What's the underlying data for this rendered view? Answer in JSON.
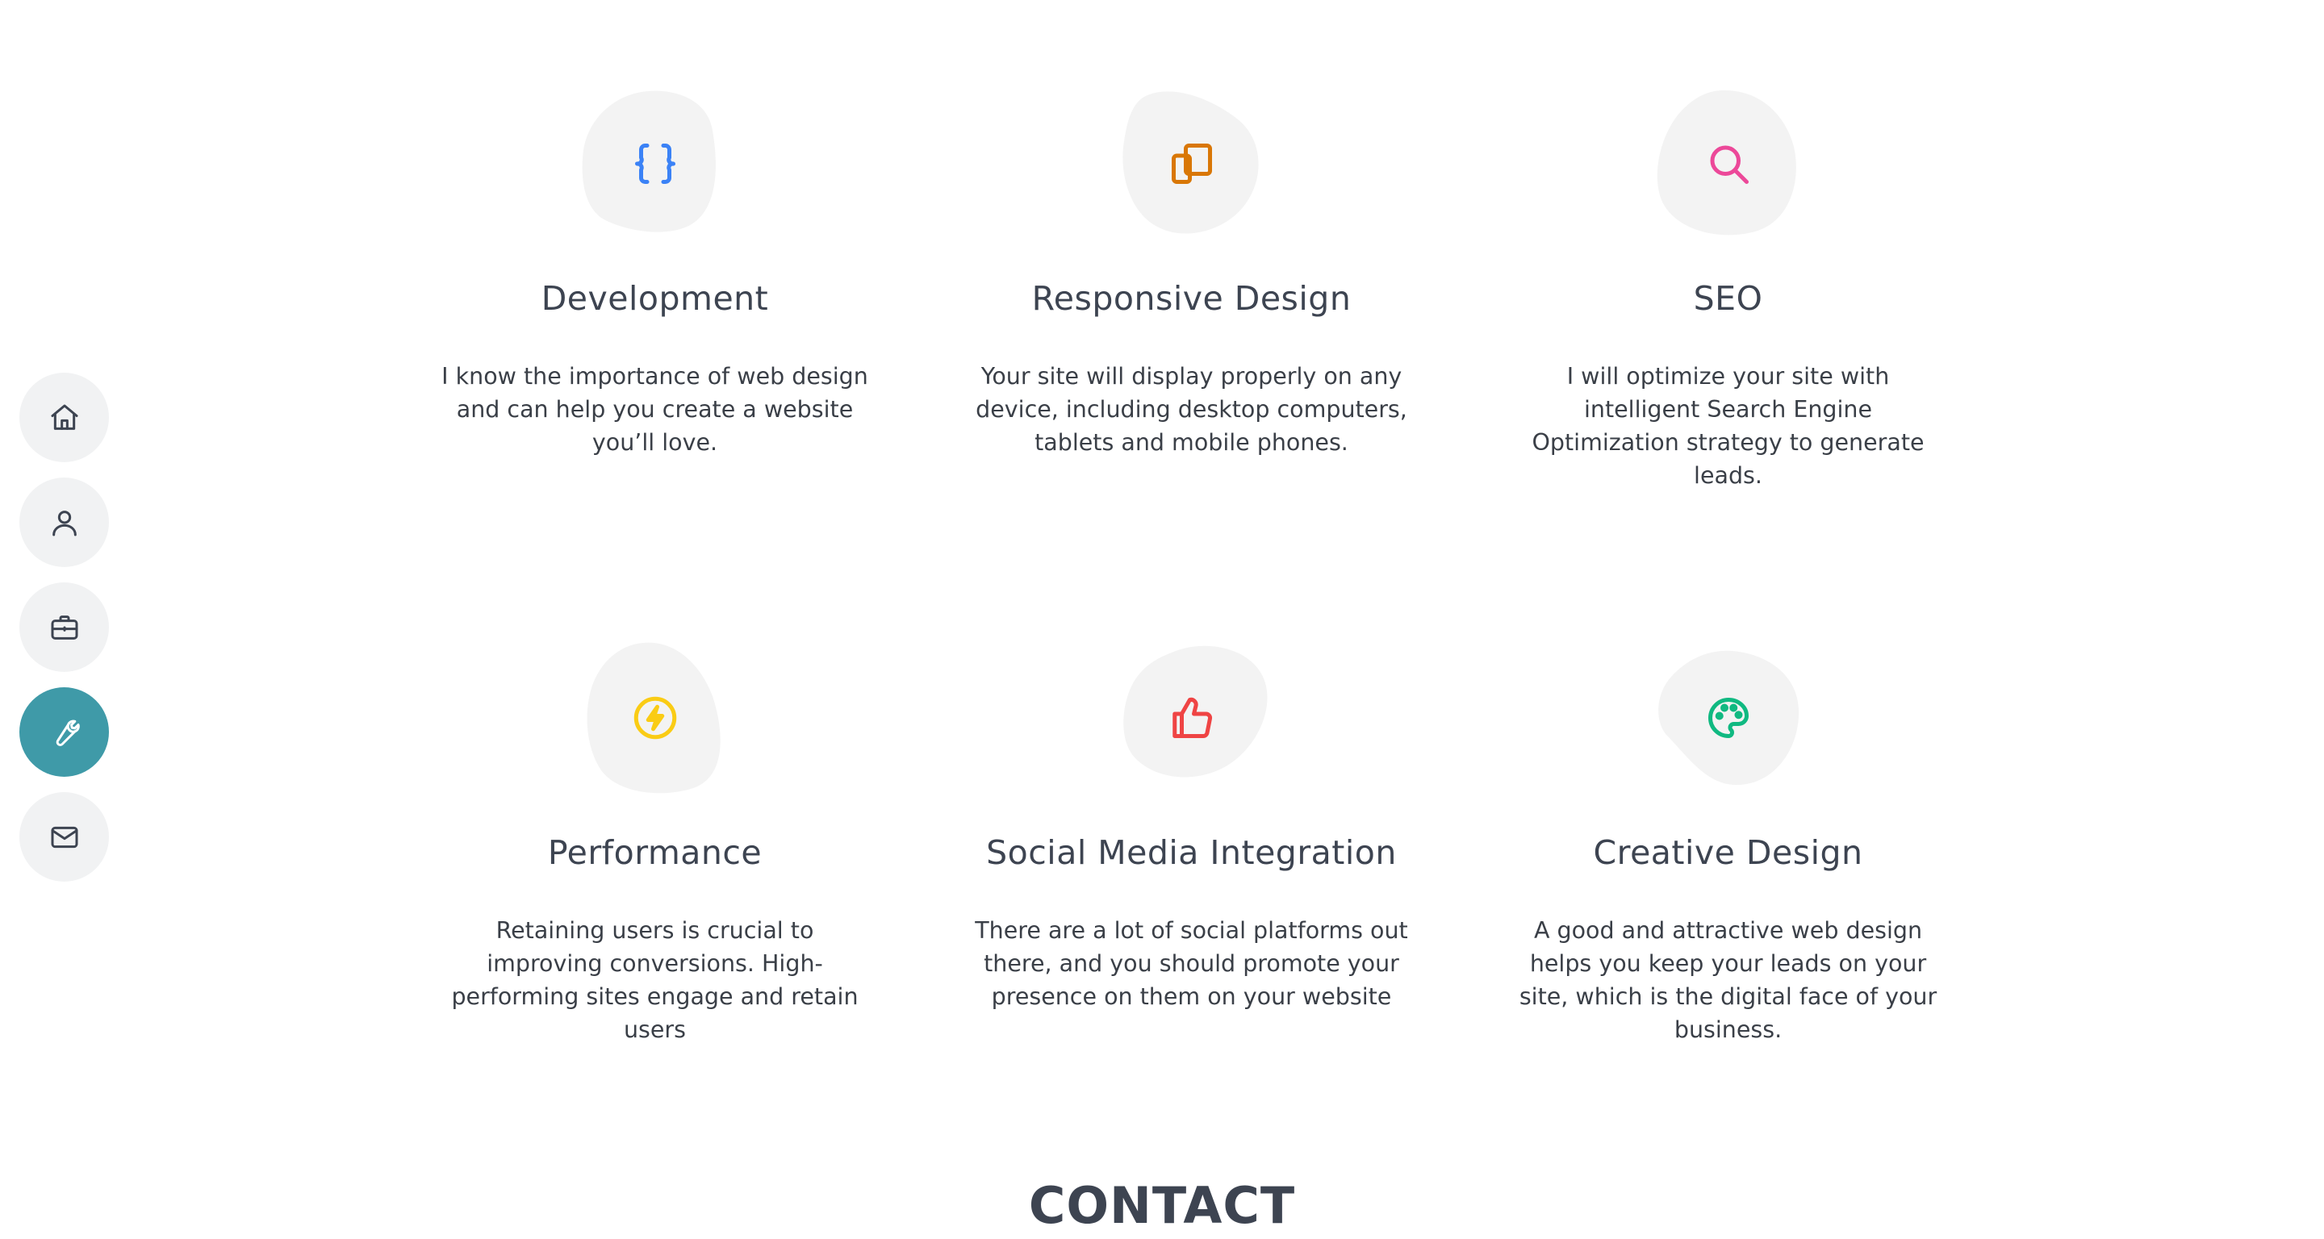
{
  "nav": {
    "items": [
      {
        "name": "home",
        "icon": "home-icon"
      },
      {
        "name": "about",
        "icon": "user-icon"
      },
      {
        "name": "portfolio",
        "icon": "briefcase-icon"
      },
      {
        "name": "services",
        "icon": "wrench-icon",
        "active": true
      },
      {
        "name": "contact",
        "icon": "mail-icon"
      }
    ],
    "active_color": "#3f9aa8"
  },
  "services": [
    {
      "title": "Development",
      "description": "I know the importance of web design and can help you create a website you’ll love.",
      "icon": "code-braces-icon",
      "icon_color": "#3b82f6"
    },
    {
      "title": "Responsive Design",
      "description": "Your site will display properly on any device, including desktop computers, tablets and mobile phones.",
      "icon": "devices-icon",
      "icon_color": "#d97706"
    },
    {
      "title": "SEO",
      "description": "I will optimize your site with intelligent Search Engine Optimization strategy to generate leads.",
      "icon": "search-icon",
      "icon_color": "#ec4899"
    },
    {
      "title": "Performance",
      "description": "Retaining users is crucial to improving conversions. High-performing sites engage and retain users",
      "icon": "bolt-icon",
      "icon_color": "#facc15"
    },
    {
      "title": "Social Media Integration",
      "description": "There are a lot of social platforms out there, and you should promote your presence on them on your website",
      "icon": "thumbs-up-icon",
      "icon_color": "#ef4444"
    },
    {
      "title": "Creative Design",
      "description": "A good and attractive web design helps you keep your leads on your site, which is the digital face of your business.",
      "icon": "palette-icon",
      "icon_color": "#10b981"
    }
  ],
  "contact": {
    "heading": "CONTACT"
  }
}
